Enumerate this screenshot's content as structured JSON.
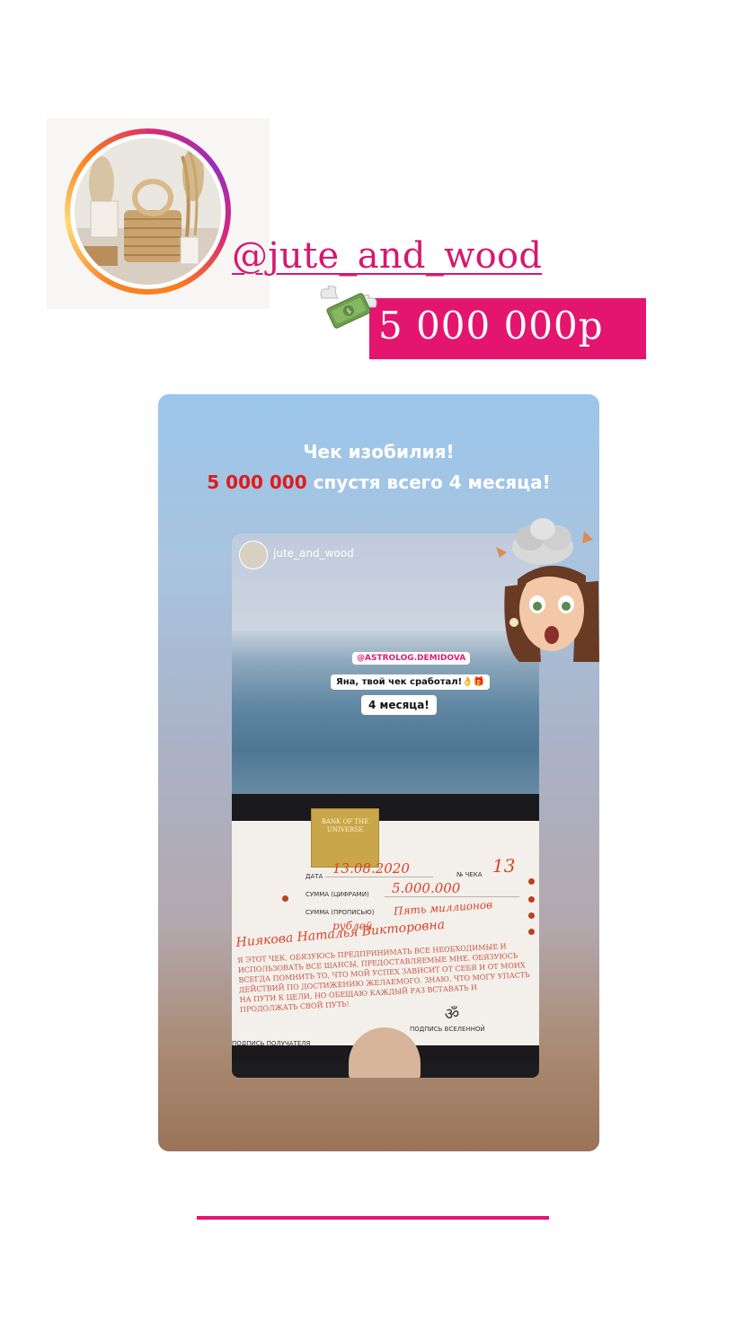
{
  "profile": {
    "handle": "@jute_and_wood",
    "amount": "5 000 000р"
  },
  "repost": {
    "title_line1": "Чек изобилия!",
    "title_highlight": "5 000 000",
    "title_line2_rest": " спустя всего 4 месяца!",
    "story": {
      "username": "jute_and_wood",
      "mention_sticker": "@ASTROLOG.DEMIDOVA",
      "message_sticker": "Яна, твой чек сработал!👌🎁",
      "months_sticker": "4 месяца!",
      "check": {
        "logo_text": "BANK OF THE UNIVERSE",
        "date_label": "ДАТА",
        "date_value": "13.08.2020",
        "number_label": "№ ЧЕКА",
        "number_value": "13",
        "sum_digits_label": "СУММА (ЦИФРАМИ)",
        "sum_digits_value": "5.000.000",
        "sum_words_label": "СУММА (ПРОПИСЬЮ)",
        "sum_words_value": "Пять миллионов",
        "sum_words_value2": "рублей",
        "recipient": "Ниякова Наталья Викторовна",
        "body_text": "Я ЭТОТ ЧЕК, ОБЯЗУЮСЬ ПРЕДПРИНИМАТЬ ВСЕ НЕОБХОДИМЫЕ И ИСПОЛЬЗОВАТЬ ВСЕ ШАНСЫ, ПРЕДОСТАВЛЯЕМЫЕ МНЕ. ОБЯЗУЮСЬ ВСЕГДА ПОМНИТЬ ТО, ЧТО МОЙ УСПЕХ ЗАВИСИТ ОТ СЕБЯ И ОТ МОИХ ДЕЙСТВИЙ ПО ДОСТИЖЕНИЮ ЖЕЛАЕМОГО. ЗНАЮ, ЧТО МОГУ УПАСТЬ НА ПУТИ К ЦЕЛИ, НО ОБЕЩАЮ КАЖДЫЙ РАЗ ВСТАВАТЬ И ПРОДОЛЖАТЬ СВОЙ ПУТЬ!",
        "sig_recipient_label": "ПОДПИСЬ ПОЛУЧАТЕЛЯ",
        "sig_universe_label": "ПОДПИСЬ ВСЕЛЕННОЙ"
      }
    }
  },
  "colors": {
    "accent": "#e4156e",
    "highlight_red": "#e11a1a"
  },
  "icons": [
    "money-with-wings-icon",
    "exploding-head-memoji-icon",
    "om-symbol-icon"
  ]
}
